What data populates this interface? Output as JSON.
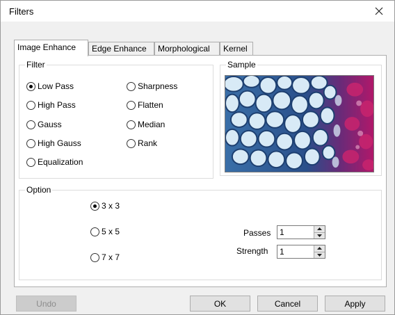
{
  "window": {
    "title": "Filters",
    "close_icon": "close-icon"
  },
  "tabs": [
    {
      "label": "Image Enhance",
      "active": true
    },
    {
      "label": "Edge Enhance",
      "active": false
    },
    {
      "label": "Morphological",
      "active": false
    },
    {
      "label": "Kernel",
      "active": false
    }
  ],
  "filter_group": {
    "label": "Filter",
    "options": [
      {
        "label": "Low Pass",
        "selected": true
      },
      {
        "label": "High Pass",
        "selected": false
      },
      {
        "label": "Gauss",
        "selected": false
      },
      {
        "label": "High Gauss",
        "selected": false
      },
      {
        "label": "Equalization",
        "selected": false
      },
      {
        "label": "Sharpness",
        "selected": false
      },
      {
        "label": "Flatten",
        "selected": false
      },
      {
        "label": "Median",
        "selected": false
      },
      {
        "label": "Rank",
        "selected": false
      }
    ]
  },
  "sample_group": {
    "label": "Sample"
  },
  "option_group": {
    "label": "Option",
    "sizes": [
      {
        "label": "3 x 3",
        "selected": true
      },
      {
        "label": "5 x 5",
        "selected": false
      },
      {
        "label": "7 x 7",
        "selected": false
      }
    ],
    "passes": {
      "label": "Passes",
      "value": "1"
    },
    "strength": {
      "label": "Strength",
      "value": "1"
    }
  },
  "buttons": {
    "undo": "Undo",
    "ok": "OK",
    "cancel": "Cancel",
    "apply": "Apply"
  }
}
